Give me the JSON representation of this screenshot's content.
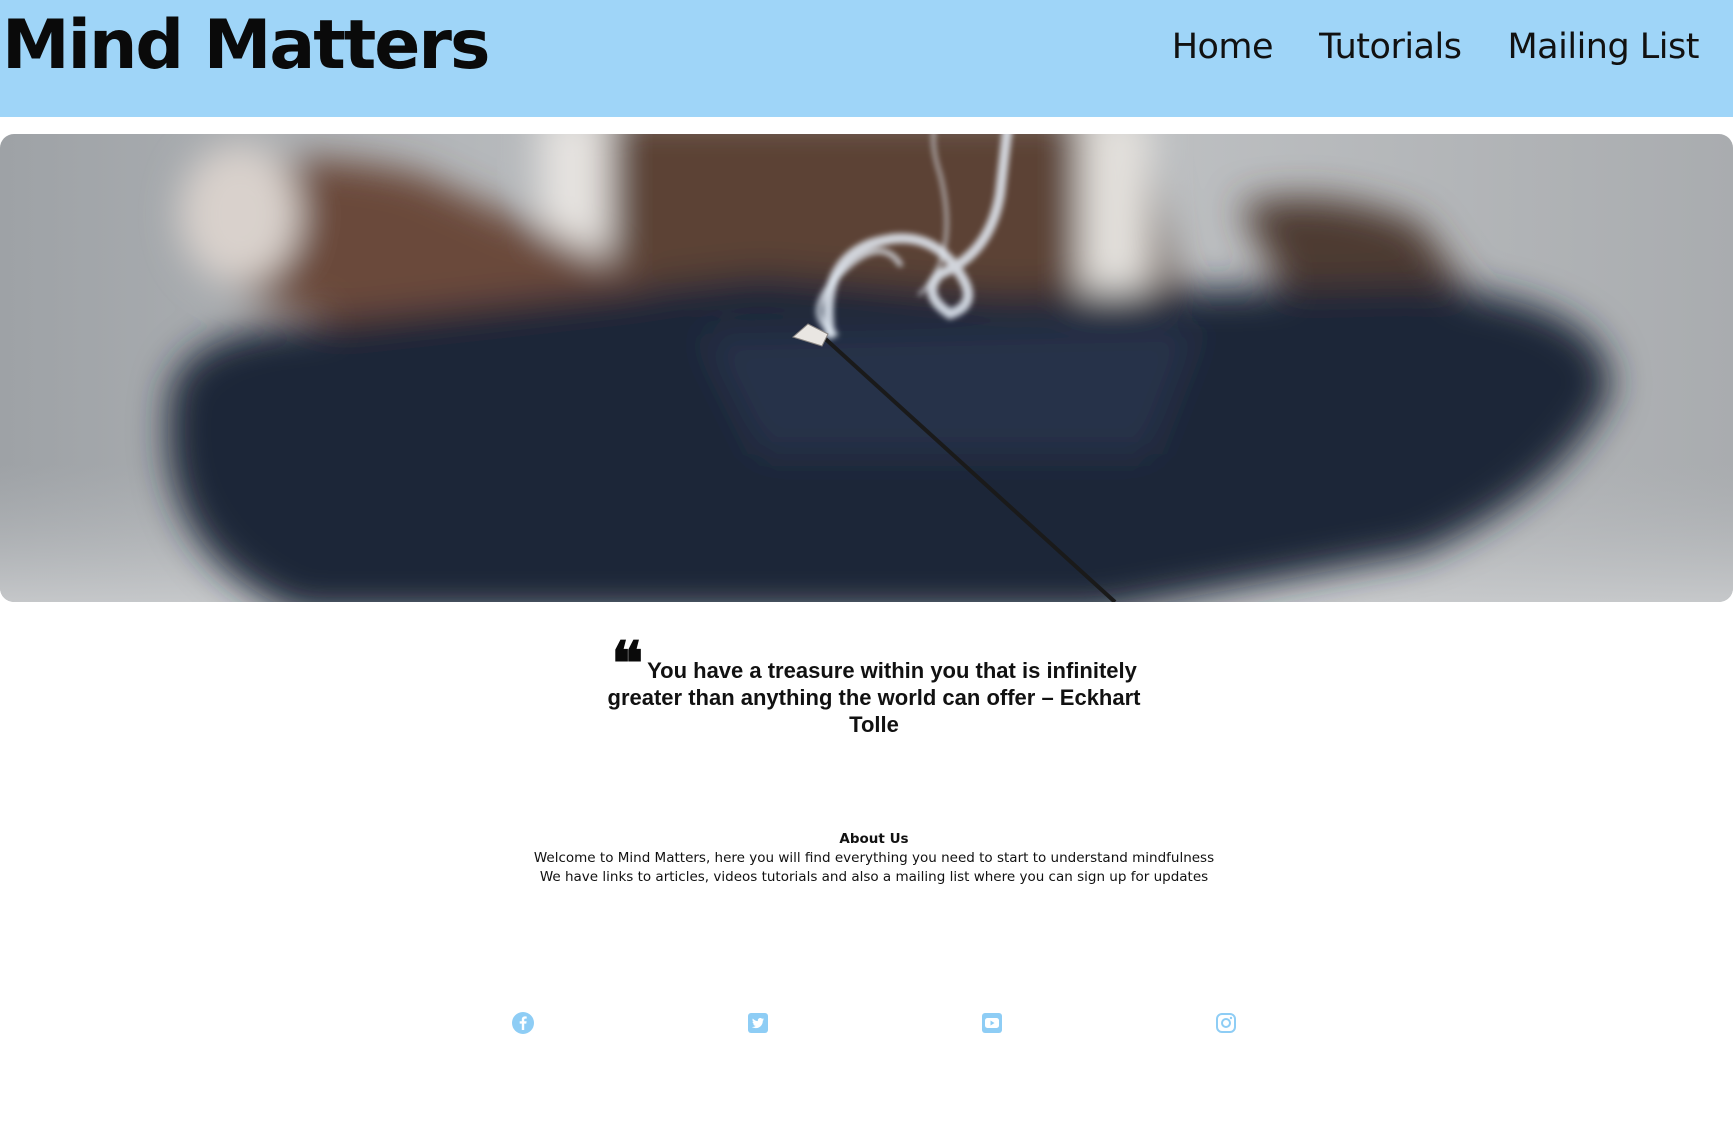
{
  "site": {
    "title": "Mind Matters"
  },
  "nav": {
    "items": [
      {
        "label": "Home"
      },
      {
        "label": "Tutorials"
      },
      {
        "label": "Mailing List"
      }
    ]
  },
  "hero": {
    "icon": "incense-meditation-photo"
  },
  "quote": {
    "mark": "❝",
    "text": "You have a treasure within you that is infinitely greater than anything the world can offer – Eckhart Tolle"
  },
  "about": {
    "heading": "About Us",
    "line1": "Welcome to Mind Matters, here you will find everything you need to start to understand mindfulness",
    "line2": "We have links to articles, videos tutorials and also a mailing list where you can sign up for updates"
  },
  "social": {
    "color": "#8ecdf5",
    "icons": [
      "facebook-icon",
      "twitter-icon",
      "youtube-icon",
      "instagram-icon"
    ]
  },
  "colors": {
    "header_bg": "#9fd5f8",
    "text": "#111111"
  }
}
